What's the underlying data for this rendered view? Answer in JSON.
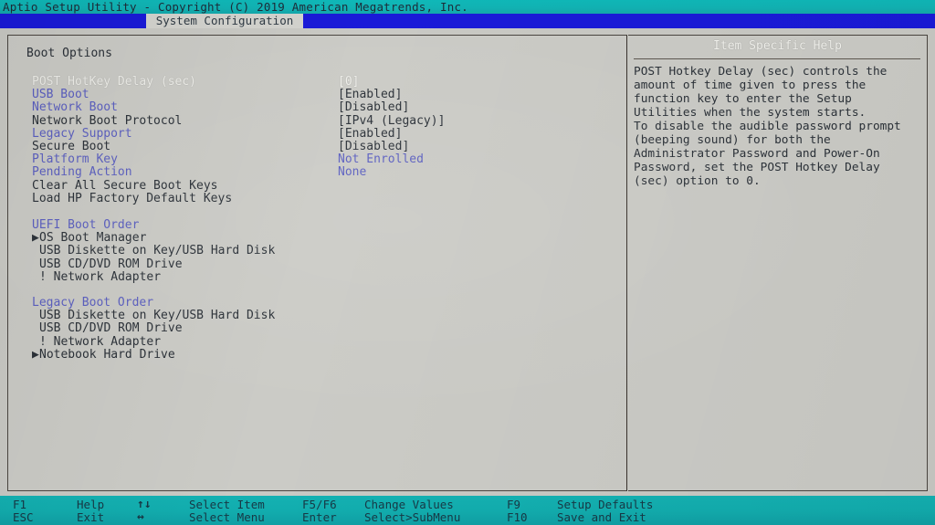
{
  "titlebar": {
    "text": "Aptio Setup Utility - Copyright (C) 2019 American Megatrends, Inc."
  },
  "tabs": {
    "active_label": "System Configuration"
  },
  "main": {
    "section_title": "Boot Options",
    "options": [
      {
        "label": "POST HotKey Delay (sec)",
        "value": "[0]",
        "label_style": "dim",
        "value_style": "dim"
      },
      {
        "label": "USB Boot",
        "value": "[Enabled]",
        "label_style": "blue",
        "value_style": "dark"
      },
      {
        "label": "Network Boot",
        "value": "[Disabled]",
        "label_style": "blue",
        "value_style": "dark"
      },
      {
        "label": "Network Boot Protocol",
        "value": "[IPv4 (Legacy)]",
        "label_style": "dark",
        "value_style": "dark"
      },
      {
        "label": "Legacy Support",
        "value": "[Enabled]",
        "label_style": "blue",
        "value_style": "dark"
      },
      {
        "label": "Secure Boot",
        "value": "[Disabled]",
        "label_style": "dark",
        "value_style": "dark"
      },
      {
        "label": "Platform Key",
        "value": "Not Enrolled",
        "label_style": "blue",
        "value_style": "blue"
      },
      {
        "label": "Pending Action",
        "value": "None",
        "label_style": "blue",
        "value_style": "blue"
      },
      {
        "label": "Clear All Secure Boot Keys",
        "value": "",
        "label_style": "dark",
        "value_style": "dark"
      },
      {
        "label": "Load HP Factory Default Keys",
        "value": "",
        "label_style": "dark",
        "value_style": "dark"
      }
    ],
    "uefi_boot_order": {
      "heading": "UEFI Boot Order",
      "items": [
        {
          "marker": "▶",
          "label": "OS Boot Manager"
        },
        {
          "marker": " ",
          "label": "USB Diskette on Key/USB Hard Disk"
        },
        {
          "marker": " ",
          "label": "USB CD/DVD ROM Drive"
        },
        {
          "marker": " ",
          "label": "! Network Adapter"
        }
      ]
    },
    "legacy_boot_order": {
      "heading": "Legacy Boot Order",
      "items": [
        {
          "marker": " ",
          "label": "USB Diskette on Key/USB Hard Disk"
        },
        {
          "marker": " ",
          "label": "USB CD/DVD ROM Drive"
        },
        {
          "marker": " ",
          "label": "! Network Adapter"
        },
        {
          "marker": "▶",
          "label": "Notebook Hard Drive"
        }
      ]
    }
  },
  "help": {
    "title": "Item Specific Help",
    "text": "POST Hotkey Delay (sec) controls the\namount of time given to press the\nfunction key to enter the Setup\nUtilities when the system starts.\nTo disable the audible password prompt\n(beeping sound) for both the\nAdministrator Password and Power-On\nPassword, set the POST Hotkey Delay\n(sec) option to 0."
  },
  "footer": {
    "keys": [
      {
        "key": "F1",
        "desc": "Help",
        "row": 1,
        "col": 1
      },
      {
        "key": "ESC",
        "desc": "Exit",
        "row": 2,
        "col": 1
      },
      {
        "key": "↑↓",
        "desc": "Select Item",
        "row": 1,
        "col": 2
      },
      {
        "key": "↔",
        "desc": "Select Menu",
        "row": 2,
        "col": 2
      },
      {
        "key": "F5/F6",
        "desc": "Change Values",
        "row": 1,
        "col": 3
      },
      {
        "key": "Enter",
        "desc": "Select>SubMenu",
        "row": 2,
        "col": 3
      },
      {
        "key": "F9",
        "desc": "Setup Defaults",
        "row": 1,
        "col": 4
      },
      {
        "key": "F10",
        "desc": "Save and Exit",
        "row": 2,
        "col": 4
      }
    ]
  },
  "colors": {
    "titlebar_bg": "#11b3b4",
    "tab_bg": "#1a1ad8",
    "panel_bg": "#c9c9c4",
    "accent_blue": "#5b5fc0",
    "text_dark": "#2b3138",
    "footer_bg": "#12adae"
  }
}
